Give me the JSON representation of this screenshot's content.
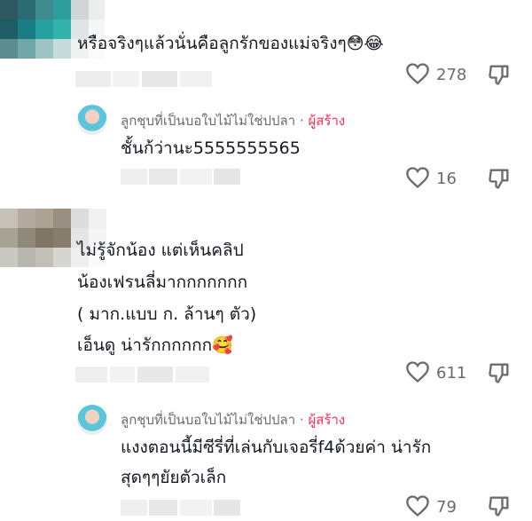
{
  "comments": [
    {
      "text_lines": [
        "หรือจริงๆแล้วนั่นคือลูกรักของแม่จริงๆ😳😂"
      ],
      "likes": "278",
      "reply": {
        "author": "ลูกชุบที่เป็นบอใบไม้ไม่ใช่ปปลา",
        "separator": " · ",
        "badge": "ผู้สร้าง",
        "text_lines": [
          "ชั้นก้ว่านะ5555555565"
        ],
        "likes": "16"
      }
    },
    {
      "text_lines": [
        "ไม่รู้จักน้อง แต่เห็นคลิป",
        "น้องเฟรนลี่มากกกกกกก",
        "( มาก.แบบ ก. ล้านๆ ตัว)",
        "เอ็นดู น่ารักกกกกก🥰"
      ],
      "likes": "611",
      "reply": {
        "author": "ลูกชุบที่เป็นบอใบไม้ไม่ใช่ปปลา",
        "separator": " · ",
        "badge": "ผู้สร้าง",
        "text_lines": [
          "แงงตอนนี้มีซีรี่ที่เล่นกับเจอรี่f4ด้วยค่า น่ารัก",
          "สุดๆๆยัยตัวเล็ก"
        ],
        "likes": "79"
      }
    }
  ],
  "icons": {
    "like": "heart-outline-icon",
    "dislike": "thumbs-down-outline-icon"
  },
  "colors": {
    "creator_badge": "#fe2c55",
    "text": "#161823",
    "meta": "#6b6b6b"
  }
}
